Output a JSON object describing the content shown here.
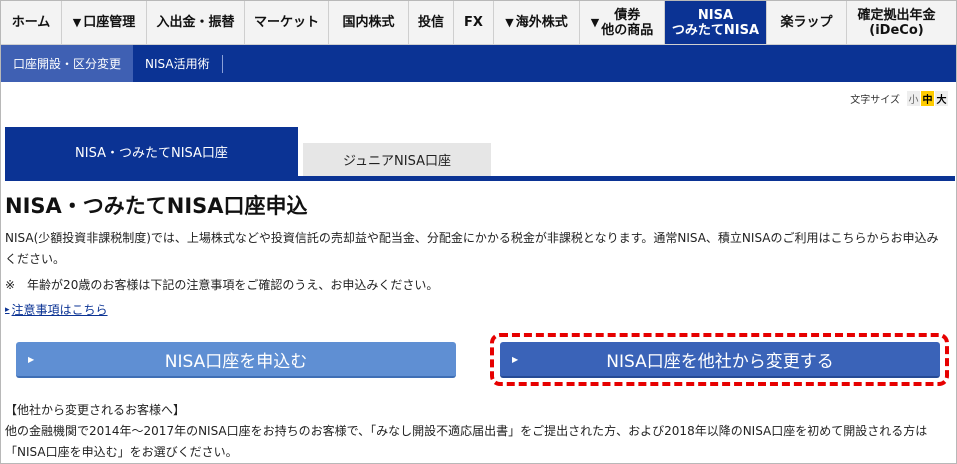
{
  "topnav": {
    "items": [
      {
        "label": "ホーム",
        "arrow": false
      },
      {
        "label": "口座管理",
        "arrow": true
      },
      {
        "label": "入出金・振替",
        "arrow": false
      },
      {
        "label": "マーケット",
        "arrow": false
      },
      {
        "label": "国内株式",
        "arrow": false
      },
      {
        "label": "投信",
        "arrow": false
      },
      {
        "label": "FX",
        "arrow": false
      },
      {
        "label": "海外株式",
        "arrow": true
      },
      {
        "line1": "債券",
        "line2": "他の商品",
        "arrow": true
      },
      {
        "line1": "NISA",
        "line2": "つみたてNISA",
        "active": true
      },
      {
        "label": "楽ラップ",
        "arrow": false
      },
      {
        "line1": "確定拠出年金",
        "line2": "(iDeCo)"
      }
    ],
    "arrow_glyph": "▼"
  },
  "subnav": {
    "items": [
      {
        "label": "口座開設・区分変更",
        "active": true
      },
      {
        "label": "NISA活用術",
        "active": false
      }
    ]
  },
  "font_size": {
    "label": "文字サイズ",
    "small": "小",
    "medium": "中",
    "large": "大",
    "selected": "中"
  },
  "tabs": {
    "active": "NISA・つみたてNISA口座",
    "other": "ジュニアNISA口座"
  },
  "main": {
    "title": "NISA・つみたてNISA口座申込",
    "description": "NISA(少額投資非課税制度)では、上場株式などや投資信託の売却益や配当金、分配金にかかる税金が非課税となります。通常NISA、積立NISAのご利用はこちらからお申込みください。",
    "note": "※　年齢が20歳のお客様は下記の注意事項をご確認のうえ、お申込みください。",
    "link": "注意事項はこちら",
    "apply_button": "NISA口座を申込む",
    "transfer_button": "NISA口座を他社から変更する",
    "transfer_heading": "【他社から変更されるお客様へ】",
    "transfer_text": "他の金融機関で2014年～2017年のNISA口座をお持ちのお客様で、「みなし開設不適応届出書」をご提出された方、および2018年以降のNISA口座を初めて開設される方は「NISA口座を申込む」をお選びください。"
  },
  "colors": {
    "brand_blue": "#0b3394",
    "button_light": "#5f8fd3",
    "button_dark": "#3a63b8",
    "highlight_red": "#e60000"
  }
}
